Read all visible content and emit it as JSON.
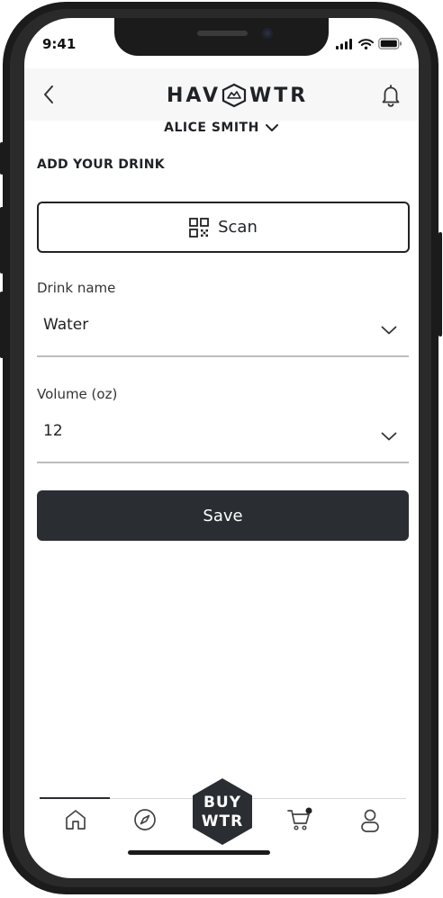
{
  "status_bar": {
    "time": "9:41"
  },
  "header": {
    "logo_left": "HAV",
    "logo_right": "WTR",
    "user_name": "ALICE SMITH"
  },
  "page": {
    "section_title": "ADD YOUR DRINK"
  },
  "scan_button": {
    "label": "Scan"
  },
  "fields": {
    "drink_name": {
      "label": "Drink name",
      "value": "Water"
    },
    "volume": {
      "label": "Volume (oz)",
      "value": "12"
    }
  },
  "save_button": {
    "label": "Save"
  },
  "tabbar": {
    "buy_line1": "BUY",
    "buy_line2": "WTR",
    "items": [
      "home-icon",
      "compass-icon",
      "buy-wtr-badge",
      "cart-icon",
      "profile-icon"
    ]
  }
}
